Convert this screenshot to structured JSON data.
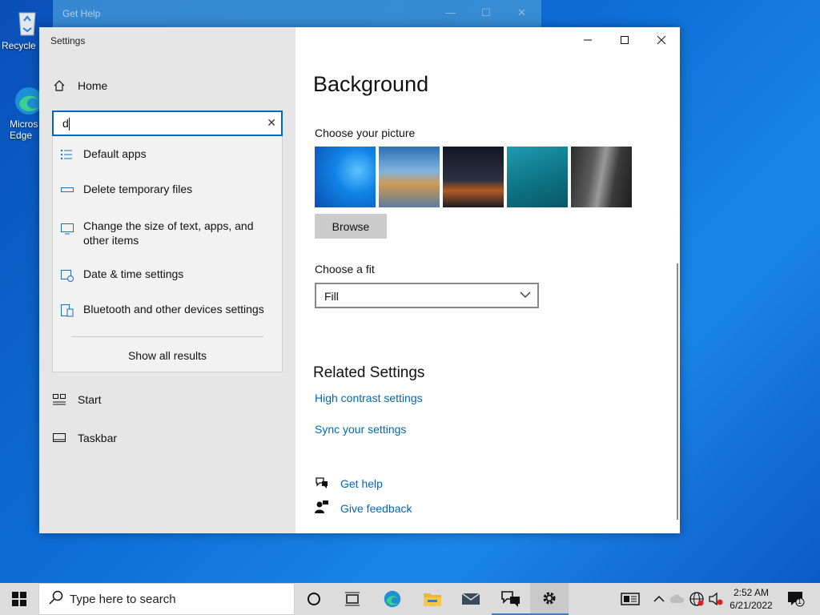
{
  "desktop": {
    "icons": [
      {
        "label": "Recycle"
      },
      {
        "label": "Micros Edge"
      }
    ]
  },
  "bg_window": {
    "title": "Get Help"
  },
  "settings": {
    "window_title": "Settings",
    "home_label": "Home",
    "search": {
      "value": "d"
    },
    "suggestions": [
      {
        "label": "Default apps",
        "icon": "default-apps-icon"
      },
      {
        "label": "Delete temporary files",
        "icon": "storage-icon"
      },
      {
        "label": "Change the size of text, apps, and other items",
        "icon": "display-icon"
      },
      {
        "label": "Date & time settings",
        "icon": "calendar-clock-icon"
      },
      {
        "label": "Bluetooth and other devices settings",
        "icon": "devices-icon"
      }
    ],
    "show_all": "Show all results",
    "nav": [
      {
        "label": "Start",
        "icon": "start-icon"
      },
      {
        "label": "Taskbar",
        "icon": "taskbar-icon"
      }
    ],
    "page_title": "Background",
    "choose_picture_label": "Choose your picture",
    "browse_label": "Browse",
    "choose_fit_label": "Choose a fit",
    "fit_value": "Fill",
    "related_title": "Related Settings",
    "related_links": [
      "High contrast settings",
      "Sync your settings"
    ],
    "help_links": [
      {
        "label": "Get help",
        "icon": "get-help-icon"
      },
      {
        "label": "Give feedback",
        "icon": "feedback-icon"
      }
    ]
  },
  "taskbar": {
    "search_placeholder": "Type here to search",
    "time": "2:52 AM",
    "date": "6/21/2022",
    "notification_count": "1"
  },
  "colors": {
    "accent": "#0067c0",
    "link": "#0067b8"
  }
}
